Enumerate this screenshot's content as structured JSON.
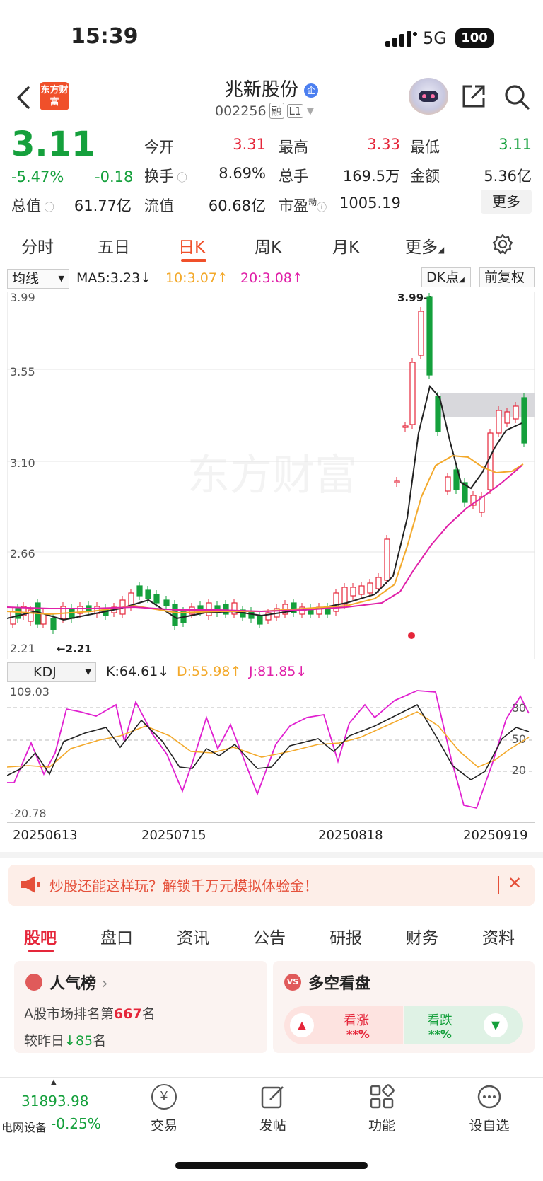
{
  "status_bar": {
    "time": "15:39",
    "network": "5G",
    "battery": "100"
  },
  "header": {
    "logo_text": "东方财富",
    "stock_name": "兆新股份",
    "name_badge": "企",
    "stock_code": "002256",
    "tag1": "融",
    "tag2": "L1"
  },
  "quote": {
    "price": "3.11",
    "change_pct": "-5.47%",
    "change_abs": "-0.18",
    "fields": [
      {
        "label": "今开",
        "value": "3.31",
        "color": "#e5263a"
      },
      {
        "label": "最高",
        "value": "3.33",
        "color": "#e5263a"
      },
      {
        "label": "最低",
        "value": "3.11",
        "color": "#15a03c"
      },
      {
        "label": "换手",
        "value": "8.69%",
        "color": "#222222"
      },
      {
        "label": "总手",
        "value": "169.5万",
        "color": "#222222"
      },
      {
        "label": "金额",
        "value": "5.36亿",
        "color": "#222222"
      },
      {
        "label": "总值",
        "value": "61.77亿",
        "color": "#222222"
      },
      {
        "label": "流值",
        "value": "60.68亿",
        "color": "#222222"
      },
      {
        "label": "市盈",
        "value": "1005.19",
        "color": "#222222"
      }
    ],
    "pe_sup": "动",
    "more_label": "更多"
  },
  "period_tabs": [
    "分时",
    "五日",
    "日K",
    "周K",
    "月K",
    "更多"
  ],
  "period_active": "日K",
  "kline_toolbar": {
    "indicator_select": "均线",
    "ma5": "MA5:3.23",
    "ma10": "10:3.07",
    "ma20": "20:3.08",
    "dk_select": "DK点",
    "adjust": "前复权",
    "ma5_color": "#222222",
    "ma10_color": "#f3a92b",
    "ma20_color": "#e020a8"
  },
  "kline_axis": {
    "y_labels": [
      "3.99",
      "3.55",
      "3.10",
      "2.66",
      "2.21"
    ],
    "high_marker": "3.99",
    "low_marker": "2.21",
    "watermark": "东方财富"
  },
  "kdj_toolbar": {
    "select": "KDJ",
    "k": "K:64.61",
    "d": "D:55.98",
    "j": "J:81.85"
  },
  "kdj_axis": {
    "top": "109.03",
    "bottom": "-20.78",
    "levels": [
      "80",
      "50",
      "20"
    ]
  },
  "x_dates": [
    "20250613",
    "20250715",
    "20250818",
    "20250919"
  ],
  "chart_data": {
    "type": "candlestick",
    "ylim": [
      2.21,
      3.99
    ],
    "recent_ohlc_note_values": {
      "high": 3.99,
      "low": 2.21,
      "last_close": 3.11
    },
    "ma": {
      "MA5": 3.23,
      "MA10": 3.07,
      "MA20": 3.08
    },
    "kdj": {
      "K": 64.61,
      "D": 55.98,
      "J": 81.85,
      "ylim": [
        -20.78,
        109.03
      ],
      "levels": [
        20,
        50,
        80
      ]
    }
  },
  "ad_banner": {
    "text": "炒股还能这样玩？解锁千万元模拟体验金！"
  },
  "info_tabs": [
    "股吧",
    "盘口",
    "资讯",
    "公告",
    "研报",
    "财务",
    "资料"
  ],
  "popularity_card": {
    "title": "人气榜",
    "rank_prefix": "A股市场排名第",
    "rank": "667",
    "rank_suffix": "名",
    "delta_prefix": "较昨日",
    "delta": "85",
    "delta_suffix": "名"
  },
  "sentiment_card": {
    "title": "多空看盘",
    "bull_label": "看涨",
    "bull_value": "**%",
    "bear_label": "看跌",
    "bear_value": "**%"
  },
  "bottom_nav": {
    "index_value": "31893.98",
    "index_name": "电网设备",
    "index_change": "-0.25%",
    "items": [
      "交易",
      "发帖",
      "功能",
      "设自选"
    ]
  }
}
